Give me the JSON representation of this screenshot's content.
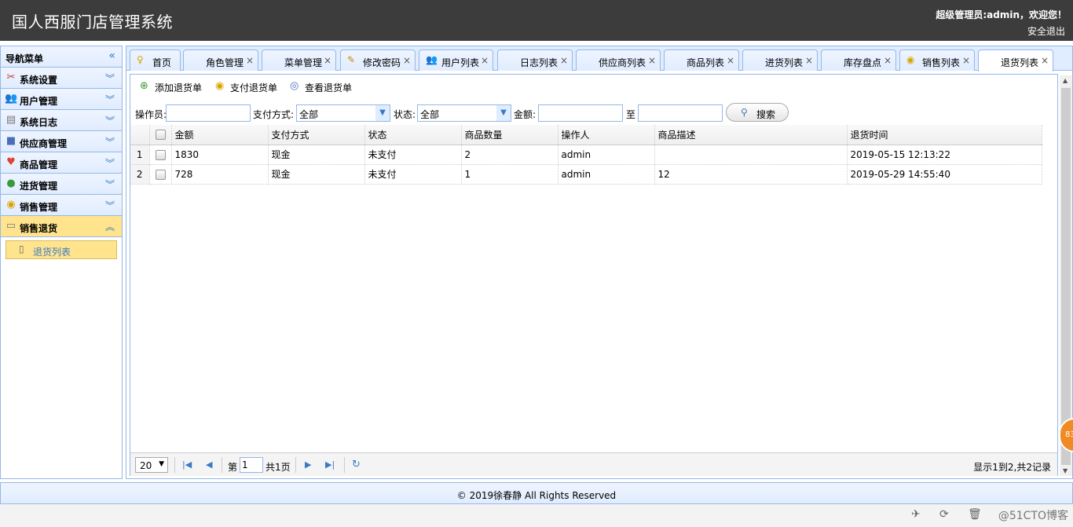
{
  "header": {
    "title": "国人西服门店管理系统",
    "welcome": "超级管理员:admin，欢迎您！",
    "logout": "安全退出"
  },
  "sidebar": {
    "title": "导航菜单",
    "items": [
      {
        "label": "系统设置",
        "icon": "tools-icon"
      },
      {
        "label": "用户管理",
        "icon": "users-icon"
      },
      {
        "label": "系统日志",
        "icon": "log-icon"
      },
      {
        "label": "供应商管理",
        "icon": "supplier-icon"
      },
      {
        "label": "商品管理",
        "icon": "heart-icon"
      },
      {
        "label": "进货管理",
        "icon": "globe-icon"
      },
      {
        "label": "销售管理",
        "icon": "coins-icon"
      },
      {
        "label": "销售退货",
        "icon": "cart-icon"
      }
    ],
    "sub_item": "退货列表"
  },
  "tabs": [
    "首页",
    "角色管理",
    "菜单管理",
    "修改密码",
    "用户列表",
    "日志列表",
    "供应商列表",
    "商品列表",
    "进货列表",
    "库存盘点",
    "销售列表",
    "退货列表"
  ],
  "toolbar": {
    "add": "添加退货单",
    "pay": "支付退货单",
    "view": "查看退货单"
  },
  "filter": {
    "operator_label": "操作员:",
    "pay_method_label": "支付方式:",
    "pay_method_value": "全部",
    "status_label": "状态:",
    "status_value": "全部",
    "amount_label": "金额:",
    "to_label": "至",
    "search_label": "搜索"
  },
  "grid": {
    "columns": [
      "金额",
      "支付方式",
      "状态",
      "商品数量",
      "操作人",
      "商品描述",
      "退货时间"
    ],
    "rows": [
      {
        "n": "1",
        "amount": "1830",
        "method": "现金",
        "status": "未支付",
        "qty": "2",
        "op": "admin",
        "desc": "",
        "time": "2019-05-15 12:13:22"
      },
      {
        "n": "2",
        "amount": "728",
        "method": "现金",
        "status": "未支付",
        "qty": "1",
        "op": "admin",
        "desc": "12",
        "time": "2019-05-29 14:55:40"
      }
    ]
  },
  "pager": {
    "page_size": "20",
    "page_prefix": "第",
    "page_value": "1",
    "page_total": "共1页",
    "info": "显示1到2,共2记录"
  },
  "footer": "© 2019徐春静 All Rights Reserved",
  "taskbar": {
    "watermark": "@51CTO博客",
    "badge": "83"
  }
}
